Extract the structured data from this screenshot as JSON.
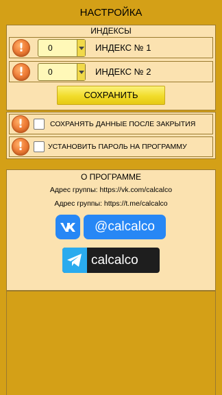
{
  "screen": {
    "title": "НАСТРОЙКА",
    "background": "#D4A017"
  },
  "indexes": {
    "header": "ИНДЕКСЫ",
    "rows": [
      {
        "value": "0",
        "label": "ИНДЕКС № 1"
      },
      {
        "value": "0",
        "label": "ИНДЕКС № 2"
      }
    ],
    "save_label": "СОХРАНИТЬ"
  },
  "options": [
    {
      "label": "СОХРАНЯТЬ ДАННЫЕ ПОСЛЕ ЗАКРЫТИЯ",
      "checked": false
    },
    {
      "label": "УСТАНОВИТЬ ПАРОЛЬ НА ПРОГРАММУ",
      "checked": false
    }
  ],
  "about": {
    "header": "О ПРОГРАММЕ",
    "lines": [
      "Адрес группы: https://vk.com/calcalco",
      "Адрес группы: https://t.me/calcalco"
    ],
    "vk_label": "@calcalco",
    "tg_label": "calcalco",
    "warning_glyph": "!",
    "icons": {
      "warning": "warning-icon",
      "vk": "vk-logo-icon",
      "telegram": "telegram-logo-icon"
    },
    "colors": {
      "vk": "#2787F5",
      "telegram": "#2AABEE",
      "save": "#F1DC2A"
    }
  }
}
